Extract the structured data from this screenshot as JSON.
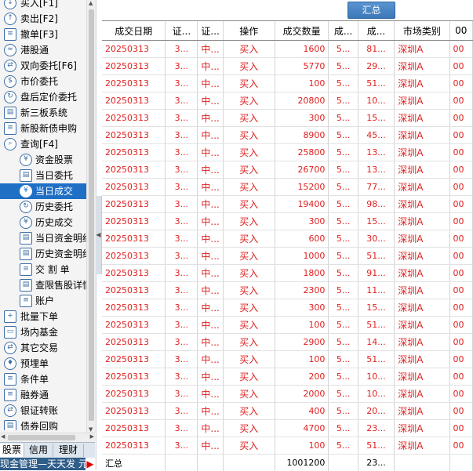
{
  "sidebar": {
    "items": [
      {
        "label": "买入[F1]",
        "icon": "buy-arrow-icon",
        "level": 0,
        "glyph": "↓"
      },
      {
        "label": "卖出[F2]",
        "icon": "sell-arrow-icon",
        "level": 0,
        "glyph": "↑"
      },
      {
        "label": "撤单[F3]",
        "icon": "cancel-order-icon",
        "level": 0,
        "glyph": "≡"
      },
      {
        "label": "港股通",
        "icon": "hk-connect-icon",
        "level": 0,
        "glyph": "≈"
      },
      {
        "label": "双向委托[F6]",
        "icon": "two-way-order-icon",
        "level": 0,
        "glyph": "⇄"
      },
      {
        "label": "市价委托",
        "icon": "market-order-icon",
        "level": 0,
        "glyph": "$"
      },
      {
        "label": "盘后定价委托",
        "icon": "after-hours-order-icon",
        "level": 0,
        "glyph": "↻"
      },
      {
        "label": "新三板系统",
        "icon": "neeq-icon",
        "level": 0,
        "glyph": "▤"
      },
      {
        "label": "新股新债申购",
        "icon": "ipo-subscribe-icon",
        "level": 0,
        "glyph": "≡"
      },
      {
        "label": "查询[F4]",
        "icon": "search-icon",
        "level": 0,
        "glyph": "⌕"
      },
      {
        "label": "资金股票",
        "icon": "funds-stocks-icon",
        "level": 1,
        "glyph": "¥"
      },
      {
        "label": "当日委托",
        "icon": "today-orders-icon",
        "level": 1,
        "glyph": "▤"
      },
      {
        "label": "当日成交",
        "icon": "today-trades-icon",
        "level": 1,
        "glyph": "¥",
        "selected": true
      },
      {
        "label": "历史委托",
        "icon": "history-orders-icon",
        "level": 1,
        "glyph": "↻"
      },
      {
        "label": "历史成交",
        "icon": "history-trades-icon",
        "level": 1,
        "glyph": "¥"
      },
      {
        "label": "当日资金明细",
        "icon": "today-funds-detail-icon",
        "level": 1,
        "glyph": "▤"
      },
      {
        "label": "历史资金明细",
        "icon": "history-funds-detail-icon",
        "level": 1,
        "glyph": "▤"
      },
      {
        "label": "交 割 单",
        "icon": "settlement-icon",
        "level": 1,
        "glyph": "≡"
      },
      {
        "label": "查限售股详情",
        "icon": "restricted-shares-icon",
        "level": 1,
        "glyph": "▤"
      },
      {
        "label": "账户",
        "icon": "account-icon",
        "level": 1,
        "glyph": "≡"
      },
      {
        "label": "批量下单",
        "icon": "batch-order-icon",
        "level": 0,
        "glyph": "+"
      },
      {
        "label": "场内基金",
        "icon": "exchange-fund-icon",
        "level": 0,
        "glyph": "▭"
      },
      {
        "label": "其它交易",
        "icon": "other-trade-icon",
        "level": 0,
        "glyph": "⇄"
      },
      {
        "label": "预埋单",
        "icon": "preset-order-icon",
        "level": 0,
        "glyph": "♦"
      },
      {
        "label": "条件单",
        "icon": "conditional-order-icon",
        "level": 0,
        "glyph": "≡"
      },
      {
        "label": "融券通",
        "icon": "securities-lending-icon",
        "level": 0,
        "glyph": "≡"
      },
      {
        "label": "银证转账",
        "icon": "bank-transfer-icon",
        "level": 0,
        "glyph": "⇄"
      },
      {
        "label": "债券回购",
        "icon": "bond-repo-icon",
        "level": 0,
        "glyph": "▤"
      }
    ]
  },
  "bottom_tabs": [
    "股票",
    "信用",
    "理财"
  ],
  "ticker": "现金管理—天天发  元",
  "toolbar": {
    "summary_label": "汇总"
  },
  "table": {
    "headers": [
      "成交日期",
      "证...",
      "证...",
      "操作",
      "成交数量",
      "成...",
      "成...",
      "市场类别",
      "00"
    ],
    "rows": [
      [
        "20250313",
        "3...",
        "中...",
        "买入",
        "1600",
        "5...",
        "81...",
        "深圳A",
        "00"
      ],
      [
        "20250313",
        "3...",
        "中...",
        "买入",
        "5770",
        "5...",
        "29...",
        "深圳A",
        "00"
      ],
      [
        "20250313",
        "3...",
        "中...",
        "买入",
        "100",
        "5...",
        "51...",
        "深圳A",
        "00"
      ],
      [
        "20250313",
        "3...",
        "中...",
        "买入",
        "20800",
        "5...",
        "10...",
        "深圳A",
        "00"
      ],
      [
        "20250313",
        "3...",
        "中...",
        "买入",
        "300",
        "5...",
        "15...",
        "深圳A",
        "00"
      ],
      [
        "20250313",
        "3...",
        "中...",
        "买入",
        "8900",
        "5...",
        "45...",
        "深圳A",
        "00"
      ],
      [
        "20250313",
        "3...",
        "中...",
        "买入",
        "25800",
        "5...",
        "13...",
        "深圳A",
        "00"
      ],
      [
        "20250313",
        "3...",
        "中...",
        "买入",
        "26700",
        "5...",
        "13...",
        "深圳A",
        "00"
      ],
      [
        "20250313",
        "3...",
        "中...",
        "买入",
        "15200",
        "5...",
        "77...",
        "深圳A",
        "00"
      ],
      [
        "20250313",
        "3...",
        "中...",
        "买入",
        "19400",
        "5...",
        "98...",
        "深圳A",
        "00"
      ],
      [
        "20250313",
        "3...",
        "中...",
        "买入",
        "300",
        "5...",
        "15...",
        "深圳A",
        "00"
      ],
      [
        "20250313",
        "3...",
        "中...",
        "买入",
        "600",
        "5...",
        "30...",
        "深圳A",
        "00"
      ],
      [
        "20250313",
        "3...",
        "中...",
        "买入",
        "1000",
        "5...",
        "51...",
        "深圳A",
        "00"
      ],
      [
        "20250313",
        "3...",
        "中...",
        "买入",
        "1800",
        "5...",
        "91...",
        "深圳A",
        "00"
      ],
      [
        "20250313",
        "3...",
        "中...",
        "买入",
        "2300",
        "5...",
        "11...",
        "深圳A",
        "00"
      ],
      [
        "20250313",
        "3...",
        "中...",
        "买入",
        "300",
        "5...",
        "15...",
        "深圳A",
        "00"
      ],
      [
        "20250313",
        "3...",
        "中...",
        "买入",
        "100",
        "5...",
        "51...",
        "深圳A",
        "00"
      ],
      [
        "20250313",
        "3...",
        "中...",
        "买入",
        "2900",
        "5...",
        "14...",
        "深圳A",
        "00"
      ],
      [
        "20250313",
        "3...",
        "中...",
        "买入",
        "100",
        "5...",
        "51...",
        "深圳A",
        "00"
      ],
      [
        "20250313",
        "3...",
        "中...",
        "买入",
        "200",
        "5...",
        "10...",
        "深圳A",
        "00"
      ],
      [
        "20250313",
        "3...",
        "中...",
        "买入",
        "2000",
        "5...",
        "10...",
        "深圳A",
        "00"
      ],
      [
        "20250313",
        "3...",
        "中...",
        "买入",
        "400",
        "5...",
        "20...",
        "深圳A",
        "00"
      ],
      [
        "20250313",
        "3...",
        "中...",
        "买入",
        "4700",
        "5...",
        "23...",
        "深圳A",
        "00"
      ],
      [
        "20250313",
        "3...",
        "中...",
        "买入",
        "100",
        "5...",
        "51...",
        "深圳A",
        "00"
      ]
    ],
    "total": [
      "汇总",
      "",
      "",
      "",
      "1001200",
      "",
      "23...",
      "",
      ""
    ]
  }
}
